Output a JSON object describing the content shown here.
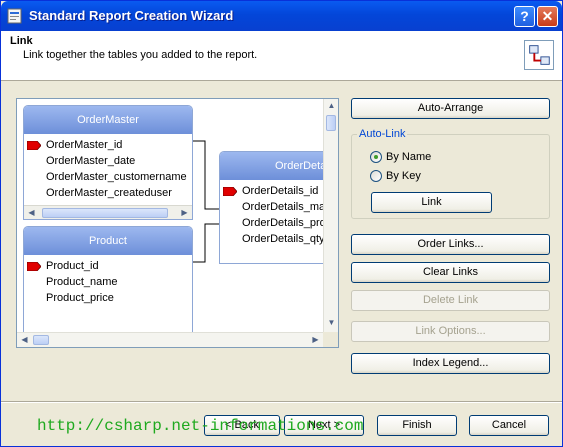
{
  "window": {
    "title": "Standard Report Creation Wizard",
    "help_label": "?",
    "close_label": "✕"
  },
  "header": {
    "title": "Link",
    "description": "Link together the tables you added to the report."
  },
  "canvas": {
    "tables": [
      {
        "name": "OrderMaster",
        "fields": [
          {
            "label": "OrderMaster_id",
            "key": true
          },
          {
            "label": "OrderMaster_date",
            "key": false
          },
          {
            "label": "OrderMaster_customername",
            "key": false
          },
          {
            "label": "OrderMaster_createduser",
            "key": false
          }
        ]
      },
      {
        "name": "OrderDetails",
        "fields": [
          {
            "label": "OrderDetails_id",
            "key": true
          },
          {
            "label": "OrderDetails_ma",
            "key": false
          },
          {
            "label": "OrderDetails_pro",
            "key": false
          },
          {
            "label": "OrderDetails_qty",
            "key": false
          }
        ]
      },
      {
        "name": "Product",
        "fields": [
          {
            "label": "Product_id",
            "key": true
          },
          {
            "label": "Product_name",
            "key": false
          },
          {
            "label": "Product_price",
            "key": false
          }
        ]
      }
    ]
  },
  "buttons": {
    "auto_arrange": "Auto-Arrange",
    "link": "Link",
    "order_links": "Order Links...",
    "clear_links": "Clear Links",
    "delete_link": "Delete Link",
    "link_options": "Link Options...",
    "index_legend": "Index Legend...",
    "back": "< Back",
    "next": "Next >",
    "finish": "Finish",
    "cancel": "Cancel"
  },
  "auto_link": {
    "label": "Auto-Link",
    "options": [
      "By Name",
      "By Key"
    ],
    "selected": "By Name"
  },
  "watermark": "http://csharp.net-informations.com"
}
